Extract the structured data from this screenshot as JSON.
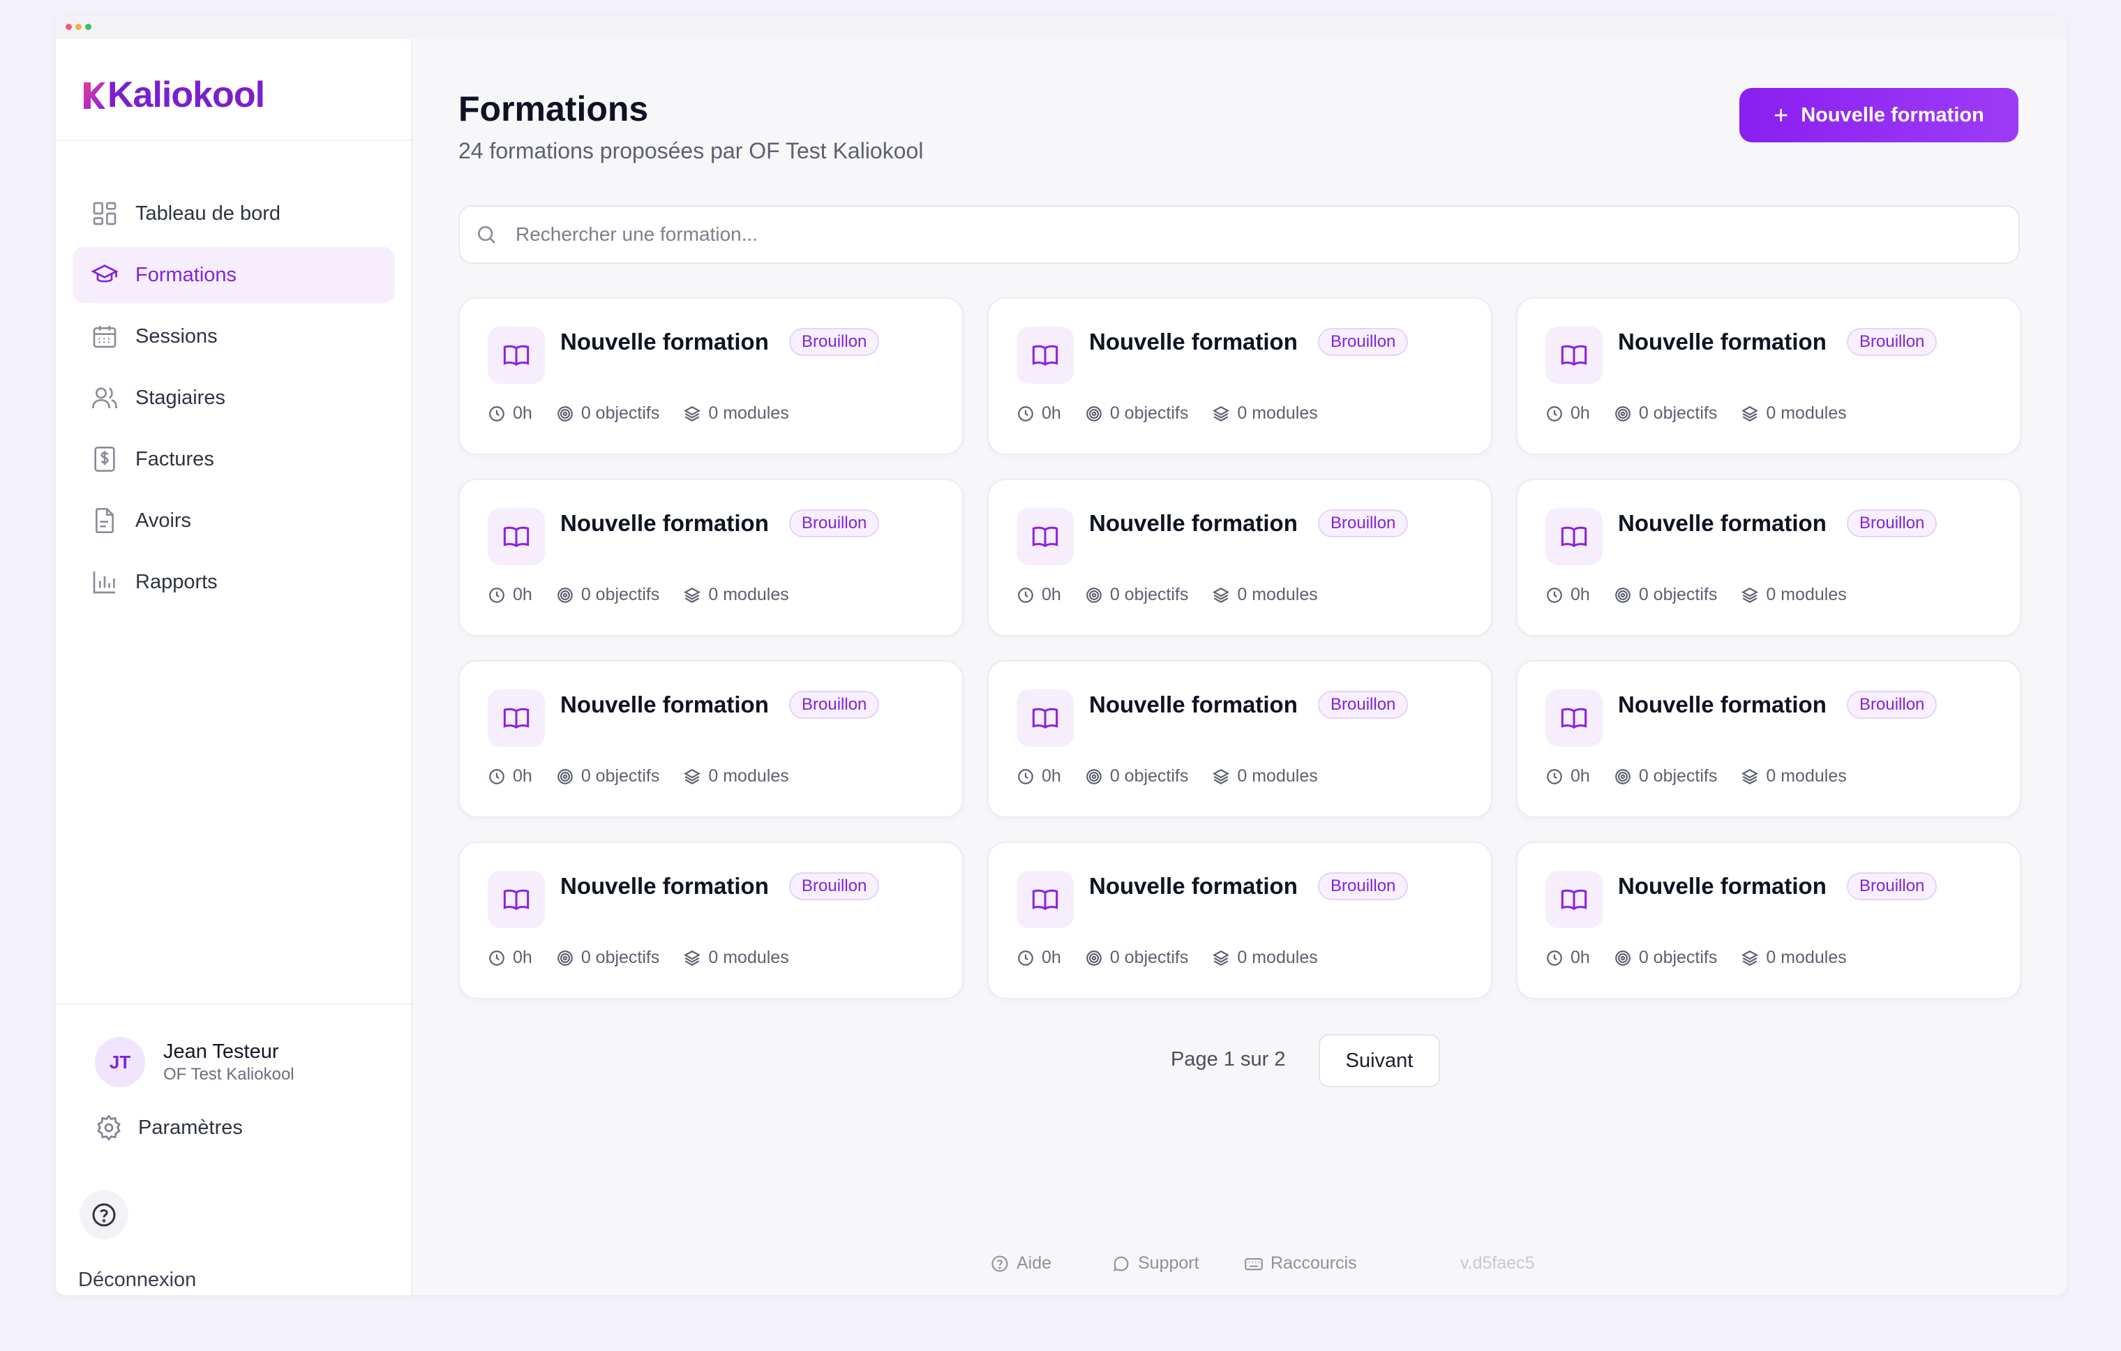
{
  "app": {
    "name": "Kaliokool",
    "brand_color": "#8124db"
  },
  "sidebar": {
    "items": [
      {
        "label": "Tableau de bord",
        "icon": "dashboard-icon",
        "active": false
      },
      {
        "label": "Formations",
        "icon": "graduation-cap-icon",
        "active": true
      },
      {
        "label": "Sessions",
        "icon": "calendar-icon",
        "active": false
      },
      {
        "label": "Stagiaires",
        "icon": "users-icon",
        "active": false
      },
      {
        "label": "Factures",
        "icon": "invoice-dollar-icon",
        "active": false
      },
      {
        "label": "Avoirs",
        "icon": "file-icon",
        "active": false
      },
      {
        "label": "Rapports",
        "icon": "bar-chart-icon",
        "active": false
      }
    ],
    "user": {
      "initials": "JT",
      "name": "Jean Testeur",
      "org": "OF Test Kaliokool"
    },
    "settings_label": "Paramètres",
    "logout_label": "Déconnexion"
  },
  "header": {
    "title": "Formations",
    "subtitle": "24 formations proposées par OF Test Kaliokool",
    "new_button_label": "Nouvelle formation"
  },
  "search": {
    "placeholder": "Rechercher une formation...",
    "value": ""
  },
  "cards": [
    {
      "title": "Nouvelle formation",
      "status": "Brouillon",
      "duration": "0h",
      "objectives": "0 objectifs",
      "modules": "0 modules"
    },
    {
      "title": "Nouvelle formation",
      "status": "Brouillon",
      "duration": "0h",
      "objectives": "0 objectifs",
      "modules": "0 modules"
    },
    {
      "title": "Nouvelle formation",
      "status": "Brouillon",
      "duration": "0h",
      "objectives": "0 objectifs",
      "modules": "0 modules"
    },
    {
      "title": "Nouvelle formation",
      "status": "Brouillon",
      "duration": "0h",
      "objectives": "0 objectifs",
      "modules": "0 modules"
    },
    {
      "title": "Nouvelle formation",
      "status": "Brouillon",
      "duration": "0h",
      "objectives": "0 objectifs",
      "modules": "0 modules"
    },
    {
      "title": "Nouvelle formation",
      "status": "Brouillon",
      "duration": "0h",
      "objectives": "0 objectifs",
      "modules": "0 modules"
    },
    {
      "title": "Nouvelle formation",
      "status": "Brouillon",
      "duration": "0h",
      "objectives": "0 objectifs",
      "modules": "0 modules"
    },
    {
      "title": "Nouvelle formation",
      "status": "Brouillon",
      "duration": "0h",
      "objectives": "0 objectifs",
      "modules": "0 modules"
    },
    {
      "title": "Nouvelle formation",
      "status": "Brouillon",
      "duration": "0h",
      "objectives": "0 objectifs",
      "modules": "0 modules"
    },
    {
      "title": "Nouvelle formation",
      "status": "Brouillon",
      "duration": "0h",
      "objectives": "0 objectifs",
      "modules": "0 modules"
    },
    {
      "title": "Nouvelle formation",
      "status": "Brouillon",
      "duration": "0h",
      "objectives": "0 objectifs",
      "modules": "0 modules"
    },
    {
      "title": "Nouvelle formation",
      "status": "Brouillon",
      "duration": "0h",
      "objectives": "0 objectifs",
      "modules": "0 modules"
    }
  ],
  "pagination": {
    "info": "Page 1 sur 2",
    "next_label": "Suivant"
  },
  "footer": {
    "help": "Aide",
    "support": "Support",
    "shortcuts": "Raccourcis",
    "version": "v.d5faec5"
  }
}
